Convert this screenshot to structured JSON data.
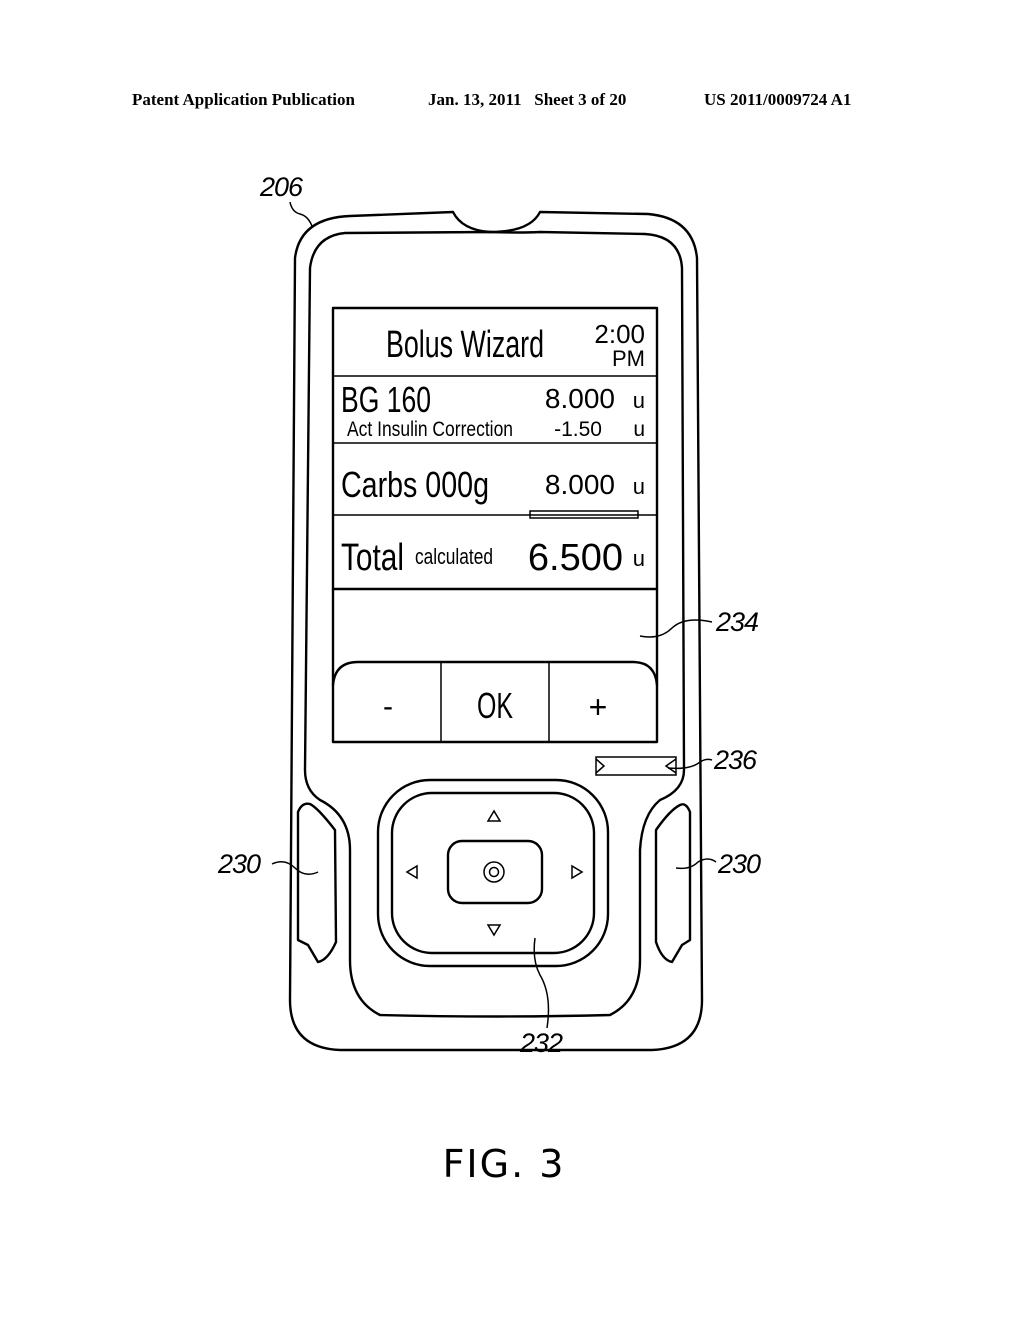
{
  "header": {
    "publication": "Patent Application Publication",
    "date_sheet": "Jan. 13, 2011   Sheet 3 of 20",
    "number": "US 2011/0009724 A1"
  },
  "screen": {
    "title": "Bolus Wizard",
    "time": "2:00",
    "ampm": "PM",
    "bg_label": "BG 160",
    "bg_value": "8.000",
    "bg_unit": "u",
    "act_insulin_label": "Act Insulin Correction",
    "act_insulin_value": "-1.50",
    "act_insulin_unit": "u",
    "carbs_label": "Carbs 000g",
    "carbs_value": "8.000",
    "carbs_unit": "u",
    "total_label": "Total",
    "total_sub": "calculated",
    "total_value": "6.500",
    "total_unit": "u",
    "buttons": {
      "minus": "-",
      "ok": "OK",
      "plus": "+"
    }
  },
  "reference_numerals": {
    "device": "206",
    "side_button_left": "230",
    "side_button_right": "230",
    "nav_pad": "232",
    "touchscreen": "234",
    "indicator": "236"
  },
  "caption": "FIG. 3"
}
